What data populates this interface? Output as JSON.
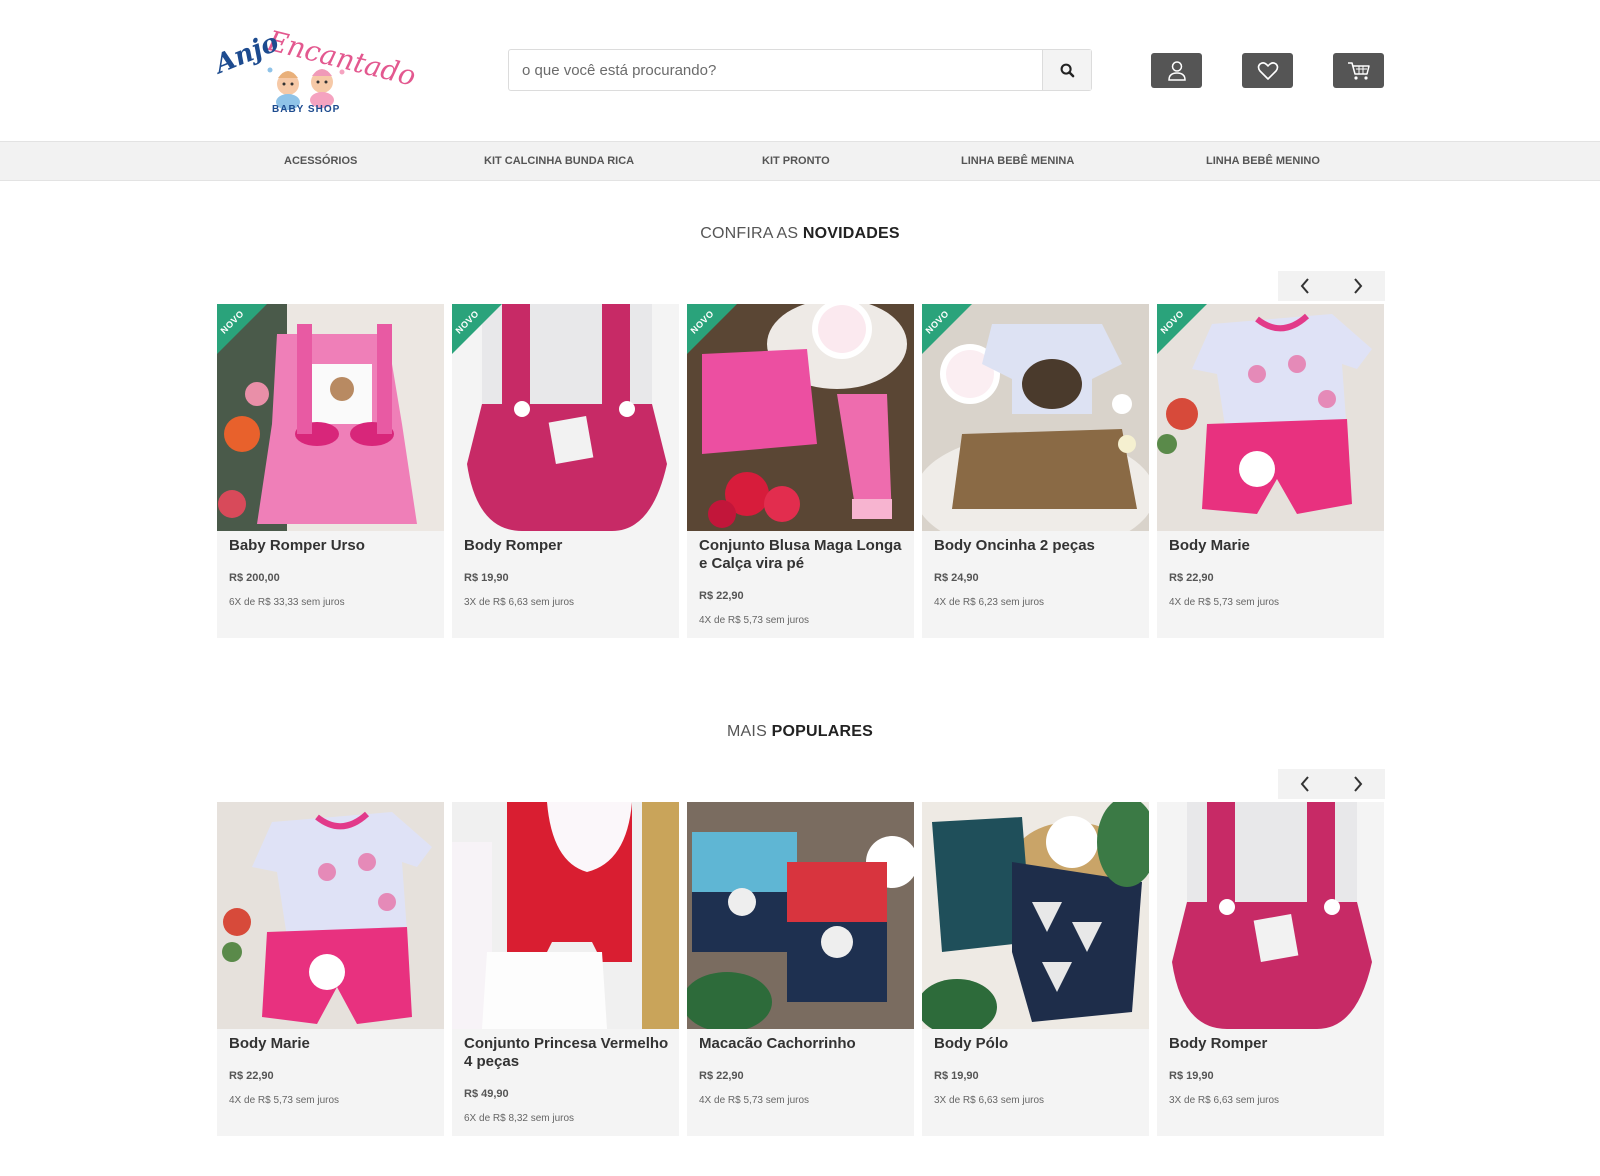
{
  "logo": {
    "line1": "Anjo",
    "line2": "Encantado",
    "sub": "BABY SHOP"
  },
  "search": {
    "placeholder": "o que você está procurando?"
  },
  "header_icons": [
    "user-icon",
    "heart-icon",
    "cart-icon"
  ],
  "nav": [
    {
      "label": "ACESSÓRIOS"
    },
    {
      "label": "KIT CALCINHA BUNDA RICA"
    },
    {
      "label": "KIT PRONTO"
    },
    {
      "label": "LINHA BEBÊ MENINA"
    },
    {
      "label": "LINHA BEBÊ MENINO"
    }
  ],
  "sections": [
    {
      "title_light": "CONFIRA AS ",
      "title_bold": "NOVIDADES",
      "products": [
        {
          "badge": "NOVO",
          "name": "Baby Romper Urso",
          "price": "R$ 200,00",
          "installments": "6X de R$ 33,33 sem juros"
        },
        {
          "badge": "NOVO",
          "name": "Body Romper",
          "price": "R$ 19,90",
          "installments": "3X de R$ 6,63 sem juros"
        },
        {
          "badge": "NOVO",
          "name": "Conjunto Blusa Maga Longa e Calça vira pé",
          "price": "R$ 22,90",
          "installments": "4X de R$ 5,73 sem juros"
        },
        {
          "badge": "NOVO",
          "name": "Body Oncinha 2 peças",
          "price": "R$ 24,90",
          "installments": "4X de R$ 6,23 sem juros"
        },
        {
          "badge": "NOVO",
          "name": "Body Marie",
          "price": "R$ 22,90",
          "installments": "4X de R$ 5,73 sem juros"
        }
      ]
    },
    {
      "title_light": "MAIS ",
      "title_bold": "POPULARES",
      "products": [
        {
          "name": "Body Marie",
          "price": "R$ 22,90",
          "installments": "4X de R$ 5,73 sem juros"
        },
        {
          "name": "Conjunto Princesa Vermelho 4 peças",
          "price": "R$ 49,90",
          "installments": "6X de R$ 8,32 sem juros"
        },
        {
          "name": "Macacão Cachorrinho",
          "price": "R$ 22,90",
          "installments": "4X de R$ 5,73 sem juros"
        },
        {
          "name": "Body Pólo",
          "price": "R$ 19,90",
          "installments": "3X de R$ 6,63 sem juros"
        },
        {
          "name": "Body Romper",
          "price": "R$ 19,90",
          "installments": "3X de R$ 6,63 sem juros"
        }
      ]
    }
  ]
}
